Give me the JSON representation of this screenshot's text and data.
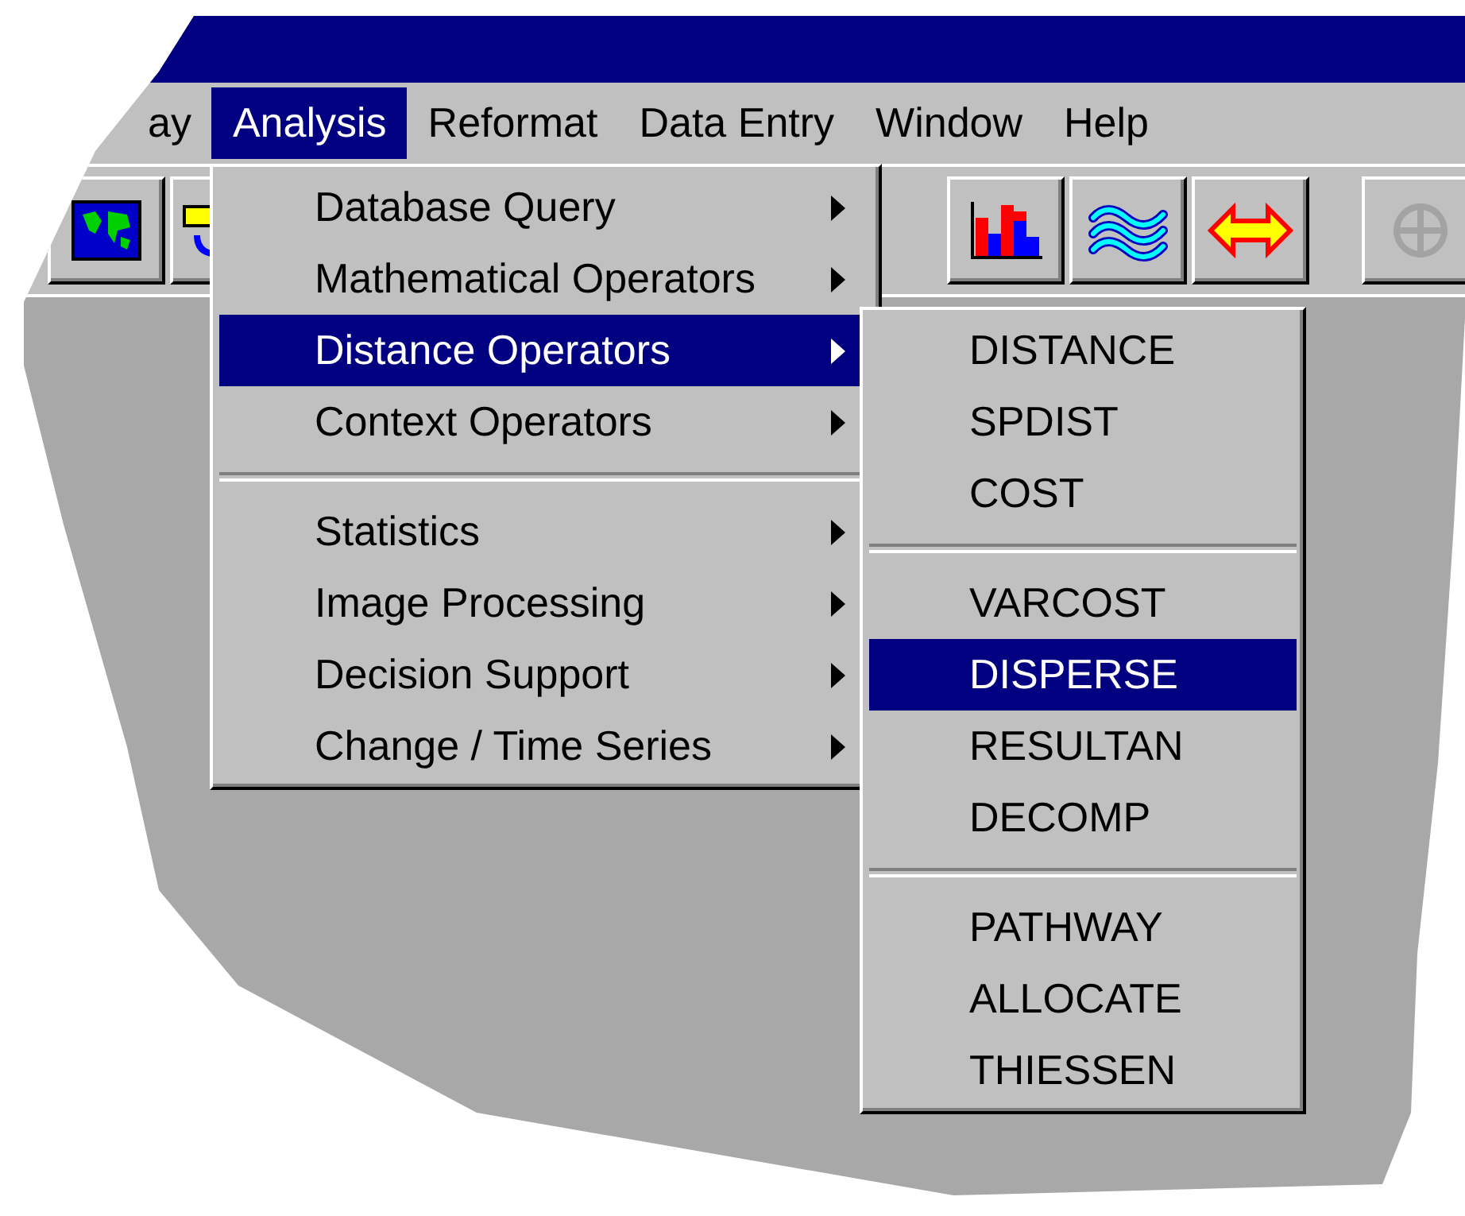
{
  "menu_bar": [
    {
      "label": "ay",
      "selected": false
    },
    {
      "label": "Analysis",
      "selected": true
    },
    {
      "label": "Reformat",
      "selected": false
    },
    {
      "label": "Data Entry",
      "selected": false
    },
    {
      "label": "Window",
      "selected": false
    },
    {
      "label": "Help",
      "selected": false
    }
  ],
  "toolbar_buttons": [
    {
      "disabled": false
    },
    {
      "disabled": false
    },
    {
      "disabled": false
    },
    {
      "disabled": false
    },
    {
      "disabled": false
    },
    {
      "disabled": true
    }
  ],
  "analysis_menu": {
    "groups": [
      [
        {
          "label": "Database Query",
          "selected": false,
          "has_submenu": true
        },
        {
          "label": "Mathematical Operators",
          "selected": false,
          "has_submenu": true
        },
        {
          "label": "Distance Operators",
          "selected": true,
          "has_submenu": true
        },
        {
          "label": "Context Operators",
          "selected": false,
          "has_submenu": true
        }
      ],
      [
        {
          "label": "Statistics",
          "selected": false,
          "has_submenu": true
        },
        {
          "label": "Image Processing",
          "selected": false,
          "has_submenu": true
        },
        {
          "label": "Decision Support",
          "selected": false,
          "has_submenu": true
        },
        {
          "label": "Change / Time Series",
          "selected": false,
          "has_submenu": true
        }
      ]
    ]
  },
  "distance_submenu": {
    "groups": [
      [
        {
          "label": "DISTANCE",
          "selected": false
        },
        {
          "label": "SPDIST",
          "selected": false
        },
        {
          "label": "COST",
          "selected": false
        }
      ],
      [
        {
          "label": "VARCOST",
          "selected": false
        },
        {
          "label": "DISPERSE",
          "selected": true
        },
        {
          "label": "RESULTAN",
          "selected": false
        },
        {
          "label": "DECOMP",
          "selected": false
        }
      ],
      [
        {
          "label": "PATHWAY",
          "selected": false
        },
        {
          "label": "ALLOCATE",
          "selected": false
        },
        {
          "label": "THIESSEN",
          "selected": false
        }
      ]
    ]
  }
}
